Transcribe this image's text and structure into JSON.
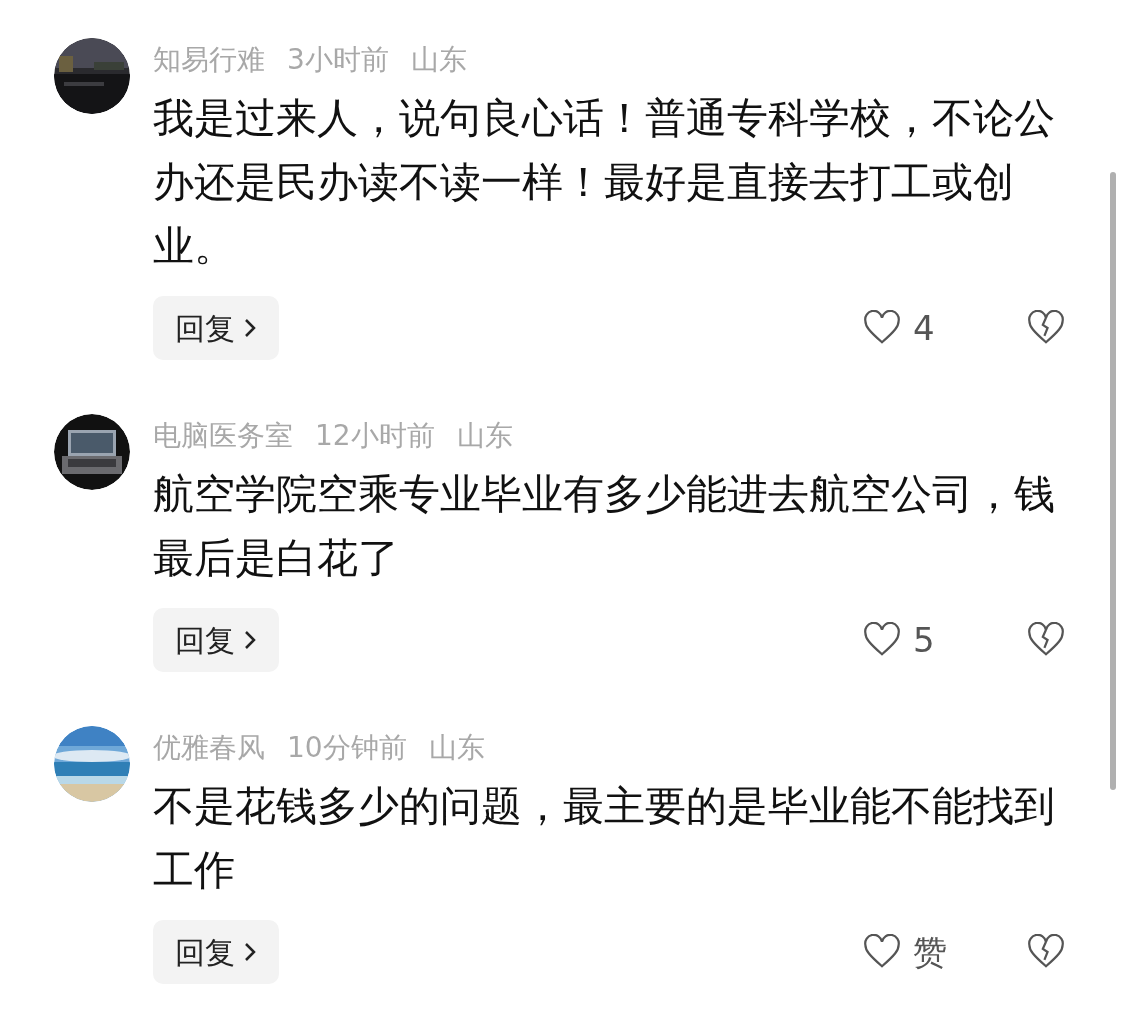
{
  "comments": [
    {
      "author": "知易行难",
      "time": "3小时前",
      "location": "山东",
      "text": "我是过来人，说句良心话！普通专科学校，不论公办还是民办读不读一样！最好是直接去打工或创业。",
      "reply": "回复",
      "likes": "4"
    },
    {
      "author": "电脑医务室",
      "time": "12小时前",
      "location": "山东",
      "text": "航空学院空乘专业毕业有多少能进去航空公司，钱最后是白花了",
      "reply": "回复",
      "likes": "5"
    },
    {
      "author": "优雅春风",
      "time": "10分钟前",
      "location": "山东",
      "text": "不是花钱多少的问题，最主要的是毕业能不能找到工作",
      "reply": "回复",
      "likes": "赞"
    }
  ]
}
